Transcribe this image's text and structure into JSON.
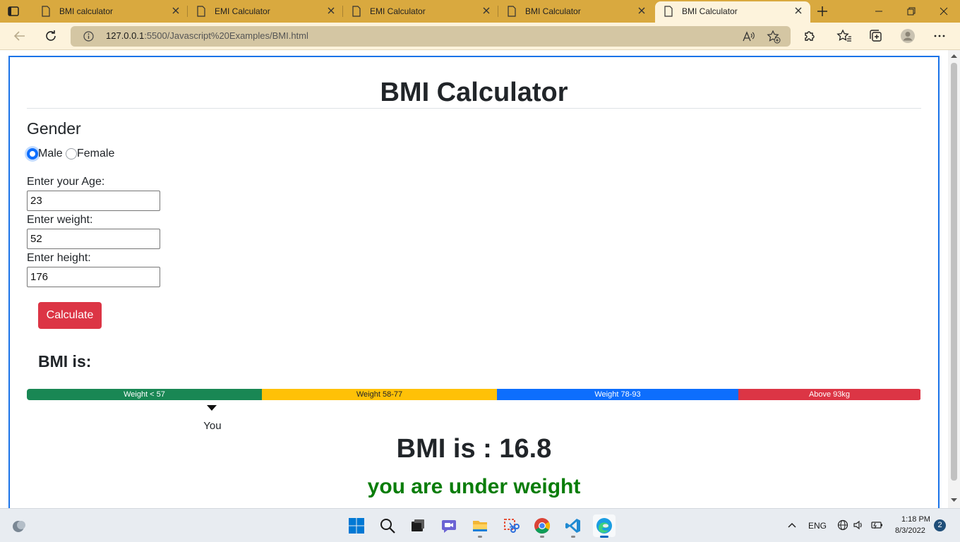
{
  "browser": {
    "tabs": [
      {
        "title": "BMI calculator",
        "active": false
      },
      {
        "title": "EMI Calculator",
        "active": false
      },
      {
        "title": "EMI Calculator",
        "active": false
      },
      {
        "title": "BMI Calculator",
        "active": false
      },
      {
        "title": "BMI Calculator",
        "active": true
      }
    ],
    "url_host": "127.0.0.1",
    "url_rest": ":5500/Javascript%20Examples/BMI.html"
  },
  "page": {
    "title": "BMI Calculator",
    "gender_heading": "Gender",
    "gender_options": [
      {
        "label": "Male",
        "checked": true
      },
      {
        "label": "Female",
        "checked": false
      }
    ],
    "age_label": "Enter your Age:",
    "age_value": "23",
    "weight_label": "Enter weight:",
    "weight_value": "52",
    "height_label": "Enter height:",
    "height_value": "176",
    "calculate_label": "Calculate",
    "bmi_label": "BMI is:",
    "bmi_result": "BMI is : 16.8",
    "bmi_status": "you are under weight",
    "status_color": "#0a7d0a",
    "you_label": "You",
    "you_position_fraction": 0.207,
    "weight_ranges": [
      {
        "label": "Weight < 57",
        "share": 0.263,
        "color": "#198754",
        "text_color": "#ffffff"
      },
      {
        "label": "Weight 58-77",
        "share": 0.263,
        "color": "#ffc107",
        "text_color": "#212529"
      },
      {
        "label": "Weight 78-93",
        "share": 0.27,
        "color": "#0d6efd",
        "text_color": "#ffffff"
      },
      {
        "label": "Above 93kg",
        "share": 0.204,
        "color": "#dc3545",
        "text_color": "#ffffff"
      }
    ]
  },
  "taskbar": {
    "apps": [
      "start",
      "search",
      "file-explorer-dark",
      "teams-chat",
      "file-explorer",
      "snipping-tool",
      "chrome",
      "vscode",
      "edge"
    ],
    "language": "ENG",
    "time": "1:18 PM",
    "date": "8/3/2022",
    "notifications": "2"
  }
}
